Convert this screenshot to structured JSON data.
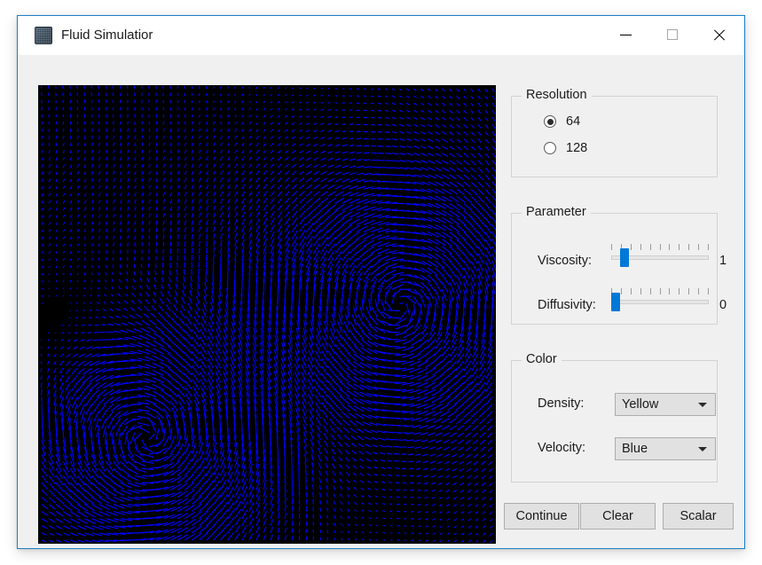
{
  "window": {
    "title": "Fluid Simulatior",
    "icon": "app-icon",
    "controls": {
      "minimize": "minimize-icon",
      "maximize": "maximize-icon",
      "close": "close-icon"
    },
    "border_color": "#1a80c4",
    "titlebar_color": "#ffffff",
    "client_color": "#f0f0f0"
  },
  "canvas": {
    "name": "fluid-simulation-canvas",
    "background_color": "#000000",
    "field_color": "#0000ff",
    "description": "velocity vector field"
  },
  "resolution": {
    "group_label": "Resolution",
    "options": [
      {
        "label": "64",
        "selected": true
      },
      {
        "label": "128",
        "selected": false
      }
    ]
  },
  "parameter": {
    "group_label": "Parameter",
    "sliders": [
      {
        "label": "Viscosity:",
        "value": "1",
        "thumb_percent": 10,
        "ticks": 11,
        "accent": "#0078d7"
      },
      {
        "label": "Diffusivity:",
        "value": "0",
        "thumb_percent": 0,
        "ticks": 11,
        "accent": "#0078d7"
      }
    ]
  },
  "color": {
    "group_label": "Color",
    "selectors": [
      {
        "label": "Density:",
        "value": "Yellow",
        "arrow": "chevron-down-icon"
      },
      {
        "label": "Velocity:",
        "value": "Blue",
        "arrow": "chevron-down-icon"
      }
    ]
  },
  "actions": {
    "continue_label": "Continue",
    "clear_label": "Clear",
    "scalar_label": "Scalar"
  }
}
